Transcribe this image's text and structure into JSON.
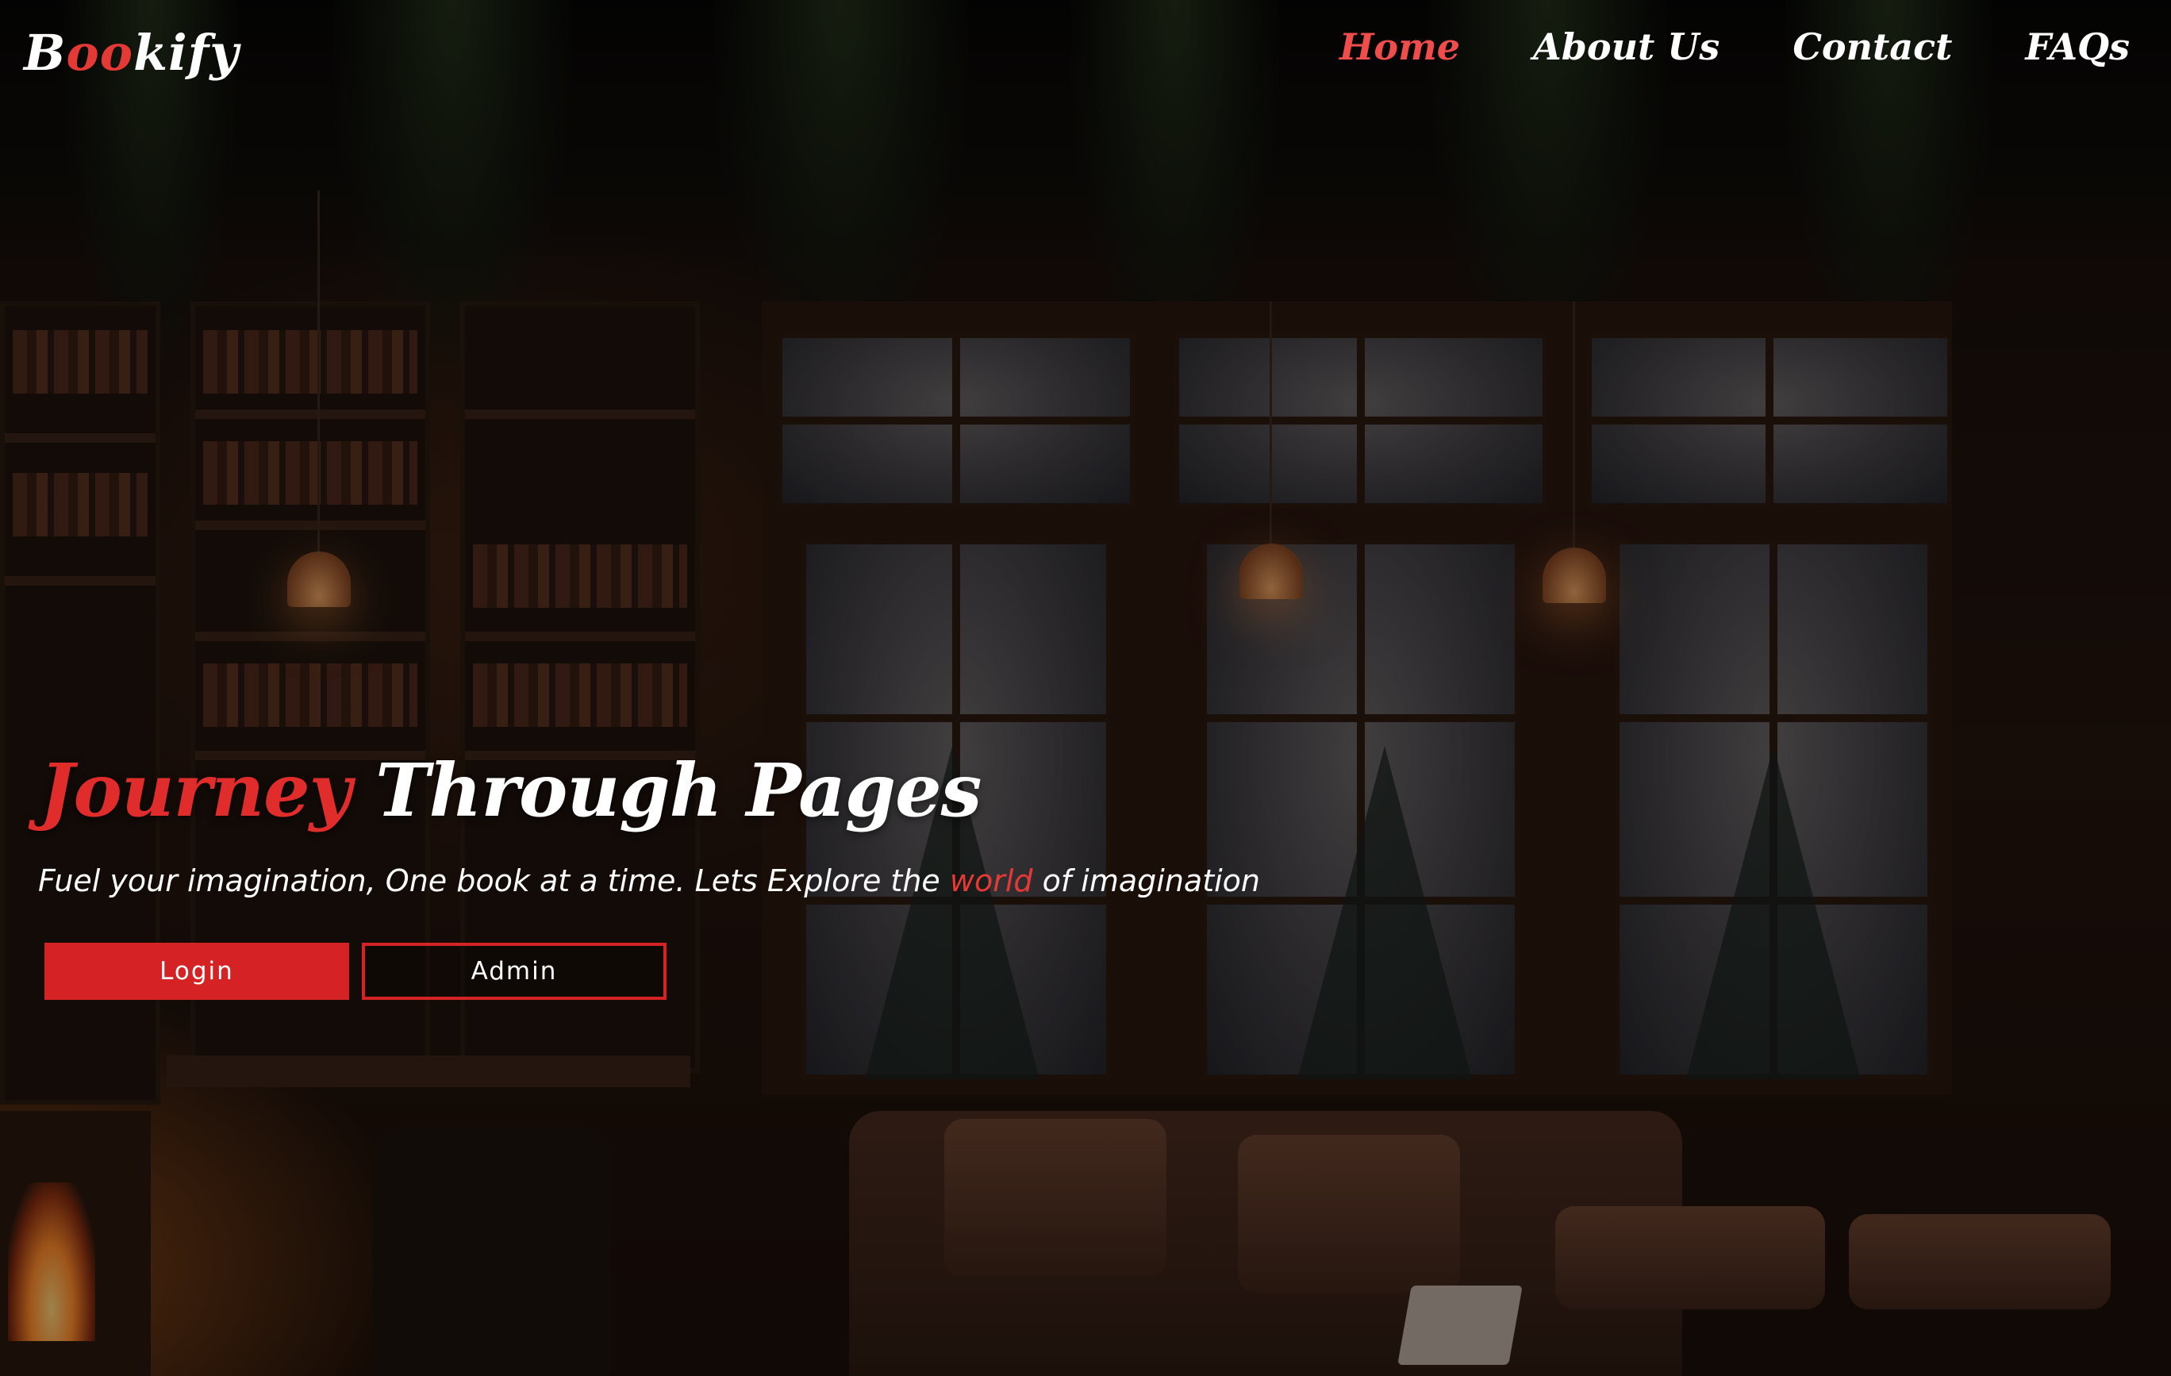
{
  "brand": {
    "logo_start": "B",
    "logo_accent": "oo",
    "logo_end": "kify"
  },
  "nav": {
    "items": [
      {
        "label": "Home",
        "active": true
      },
      {
        "label": "About Us",
        "active": false
      },
      {
        "label": "Contact",
        "active": false
      },
      {
        "label": "FAQs",
        "active": false
      }
    ]
  },
  "hero": {
    "title_accent": "Journey",
    "title_rest": " Through Pages",
    "subtitle_before": "Fuel your imagination, One book at a time. Lets Explore the ",
    "subtitle_accent": "world",
    "subtitle_after": " of imagination",
    "login_label": "Login",
    "admin_label": "Admin"
  },
  "colors": {
    "accent": "#e12c2c",
    "nav_active": "#ef4c4c",
    "button_fill": "#d52224",
    "text": "#ffffff"
  },
  "background": {
    "description_icon": "cozy-library-room-image"
  }
}
